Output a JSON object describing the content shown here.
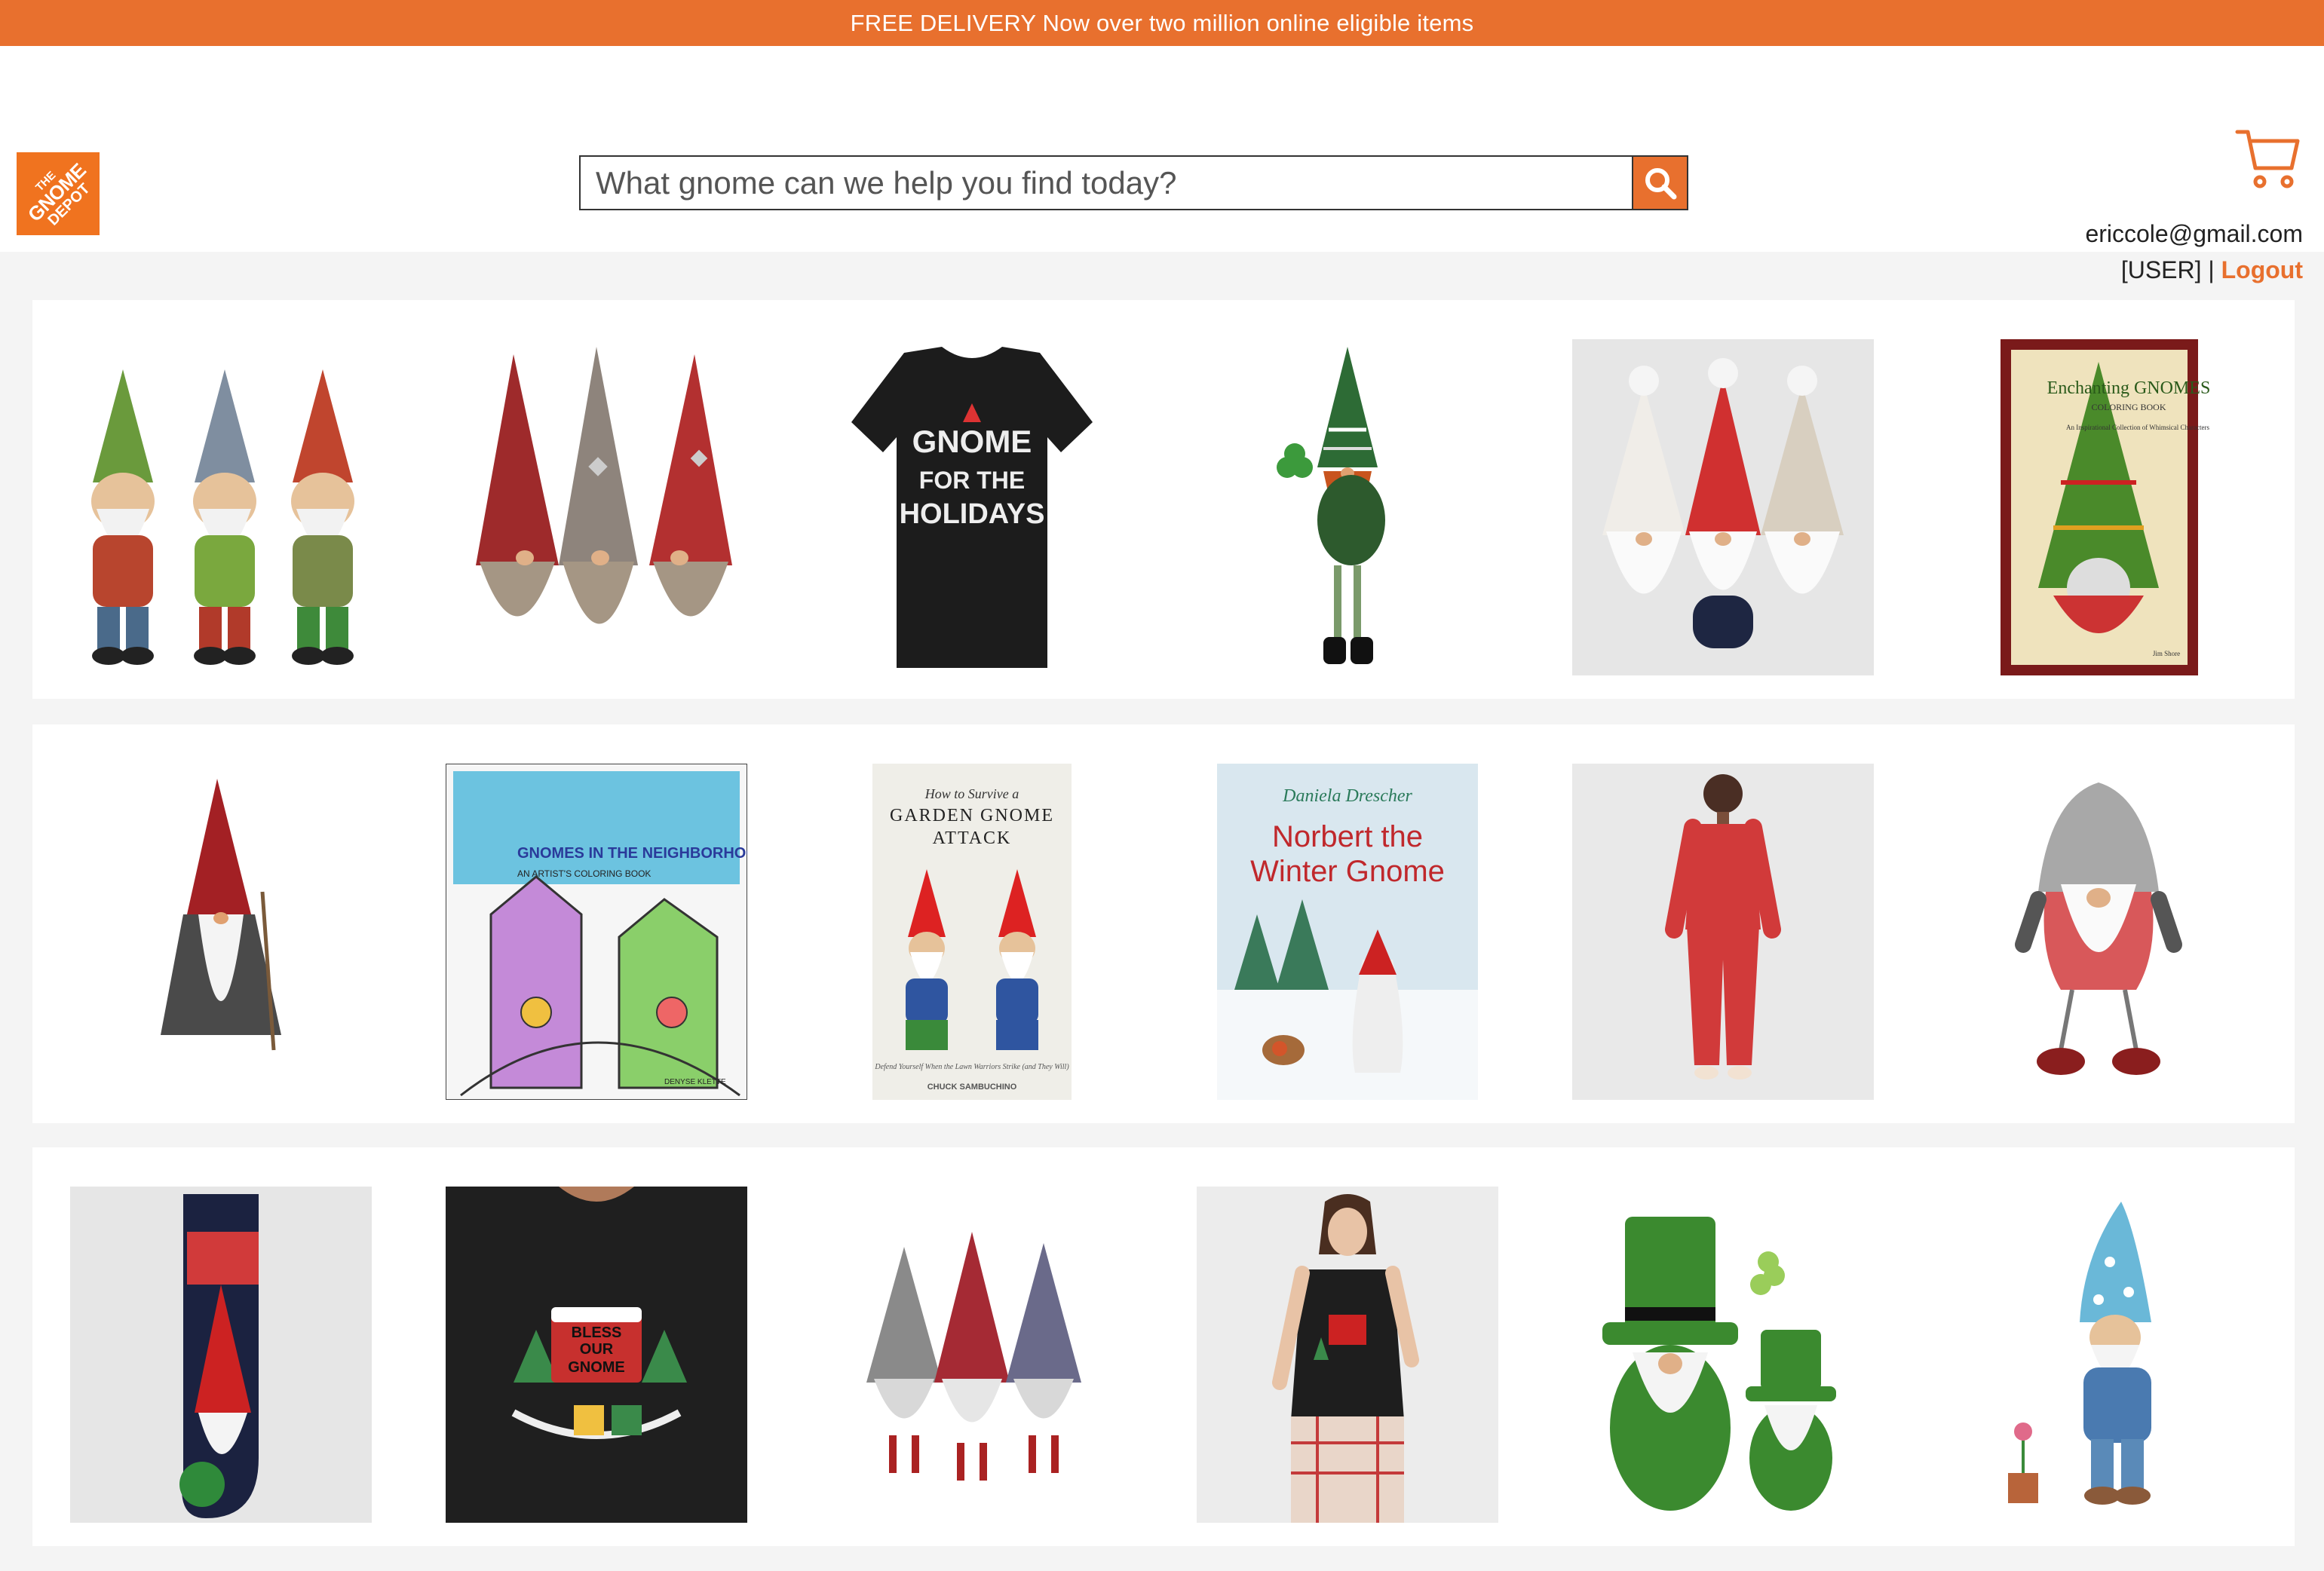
{
  "banner": {
    "text": "FREE DELIVERY Now over two million online eligible items"
  },
  "brand": {
    "line1": "THE",
    "line2": "GNOME",
    "line3": "DEPOT",
    "color": "#f0731f"
  },
  "search": {
    "placeholder": "What gnome can we help you find today?",
    "value": "",
    "icon": "search-icon"
  },
  "cart": {
    "icon": "cart-icon"
  },
  "user": {
    "email": "ericcole@gmail.com",
    "role": "[USER]",
    "separator": "|",
    "logout": "Logout"
  },
  "colors": {
    "accent": "#e8702e",
    "background": "#f4f4f4"
  },
  "products": {
    "row1": [
      {
        "name": "three wise garden gnomes statue"
      },
      {
        "name": "three plush gnomes red gray red"
      },
      {
        "name": "Gnome for the Holidays t-shirt",
        "print_line1": "GNOME",
        "print_line2": "FOR THE",
        "print_line3": "HOLIDAYS"
      },
      {
        "name": "shamrock gnome with dangly legs"
      },
      {
        "name": "three knit gnomes white red beige"
      },
      {
        "name": "Enchanting Gnomes coloring book",
        "title": "Enchanting GNOMES",
        "subtitle": "COLORING BOOK",
        "tagline": "An Inspirational Collection of Whimsical Characters",
        "author": "Jim Shore"
      }
    ],
    "row2": [
      {
        "name": "wizard gnome with gray cloak"
      },
      {
        "name": "Gnomes in the Neighborhood coloring book",
        "title": "GNOMES IN THE NEIGHBORHOOD",
        "subtitle": "AN ARTIST'S COLORING BOOK",
        "author": "DENYSE KLETTE"
      },
      {
        "name": "How to Survive a Garden Gnome Attack book",
        "line1": "How to Survive a",
        "line2": "GARDEN GNOME",
        "line3": "ATTACK",
        "tagline": "Defend Yourself When the Lawn Warriors Strike (and They Will)",
        "author": "CHUCK SAMBUCHINO"
      },
      {
        "name": "Norbert the Winter Gnome book",
        "author": "Daniela Drescher",
        "title1": "Norbert the",
        "title2": "Winter Gnome"
      },
      {
        "name": "woman gnome pajamas"
      },
      {
        "name": "faux fur hat gnome with legs"
      }
    ],
    "row3": [
      {
        "name": "gnome holiday socks"
      },
      {
        "name": "Bless Our Gnome t-shirt",
        "print_line1": "BLESS",
        "print_line2": "OUR",
        "print_line3": "GNOME"
      },
      {
        "name": "three plush gnomes holding hands"
      },
      {
        "name": "woman in gnome t-shirt"
      },
      {
        "name": "two green shamrock gnome statues"
      },
      {
        "name": "blue hat garden gnome with watering can"
      }
    ]
  }
}
